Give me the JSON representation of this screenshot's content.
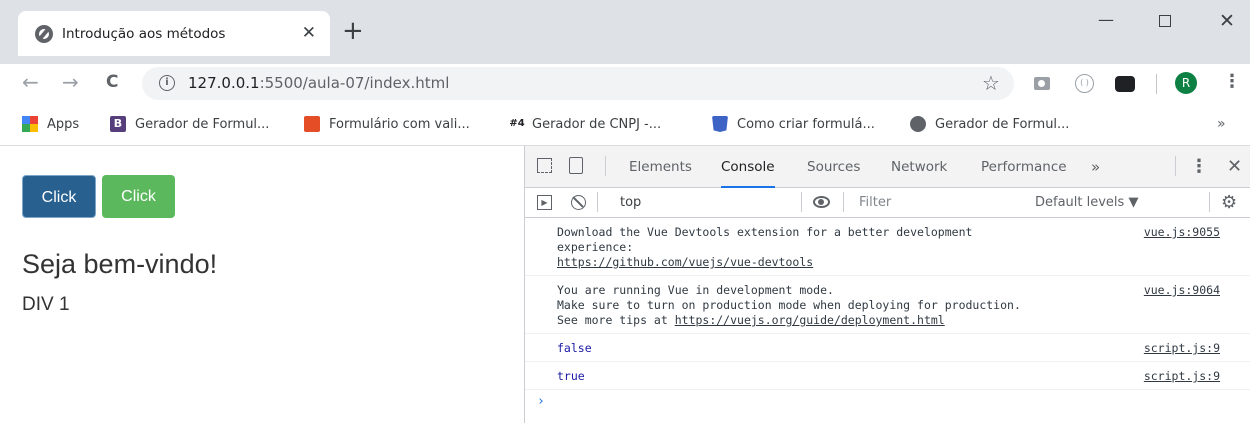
{
  "tab": {
    "title": "Introdução aos métodos"
  },
  "window": {
    "minimize": "—",
    "close": "✕"
  },
  "toolbar": {
    "url_host": "127.0.0.1",
    "url_path": ":5500/aula-07/index.html",
    "avatar_letter": "R"
  },
  "bookmarks": [
    {
      "label": "Apps",
      "icon": "apps-icon"
    },
    {
      "label": "Gerador de Formul...",
      "icon": "bootstrap-icon"
    },
    {
      "label": "Formulário com vali...",
      "icon": "html-icon"
    },
    {
      "label": "Gerador de CNPJ -...",
      "icon": "hash-icon"
    },
    {
      "label": "Como criar formulá...",
      "icon": "html5-icon"
    },
    {
      "label": "Gerador de Formul...",
      "icon": "globe-icon"
    }
  ],
  "page": {
    "button1": "Click",
    "button2": "Click",
    "welcome": "Seja bem-vindo!",
    "div1": "DIV 1"
  },
  "devtools": {
    "tabs": [
      "Elements",
      "Console",
      "Sources",
      "Network",
      "Performance"
    ],
    "active_tab": "Console",
    "context": "top",
    "filter_placeholder": "Filter",
    "levels": "Default levels ▼",
    "messages": [
      {
        "text": "Download the Vue Devtools extension for a better development\nexperience:",
        "link": "https://github.com/vuejs/vue-devtools",
        "source": "vue.js:9055"
      },
      {
        "text": "You are running Vue in development mode.\nMake sure to turn on production mode when deploying for production.\nSee more tips at ",
        "link": "https://vuejs.org/guide/deployment.html",
        "source": "vue.js:9064"
      },
      {
        "text": "false",
        "source": "script.js:9"
      },
      {
        "text": "true",
        "source": "script.js:9"
      }
    ]
  }
}
